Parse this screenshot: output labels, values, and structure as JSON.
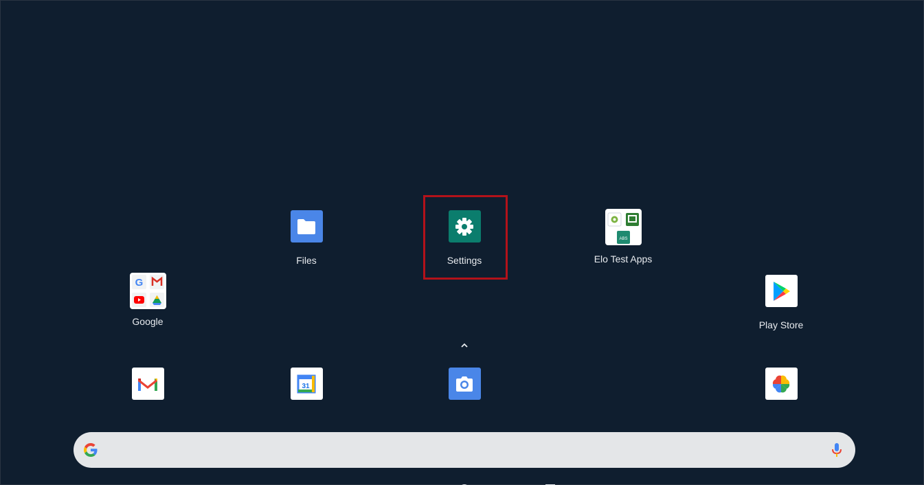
{
  "apps_row1": {
    "files": "Files",
    "settings": "Settings",
    "elo_test_apps": "Elo Test Apps"
  },
  "apps_row2": {
    "google": "Google",
    "play_store": "Play Store"
  },
  "dock": {
    "gmail": "gmail-icon",
    "calendar_day": "31",
    "camera": "camera-icon",
    "photos": "photos-icon"
  },
  "search": {
    "placeholder": ""
  },
  "colors": {
    "background": "#0f1e2f",
    "highlight": "#b3121a",
    "settings_tile": "#0b7d6d",
    "files_tile": "#4a86e8"
  }
}
